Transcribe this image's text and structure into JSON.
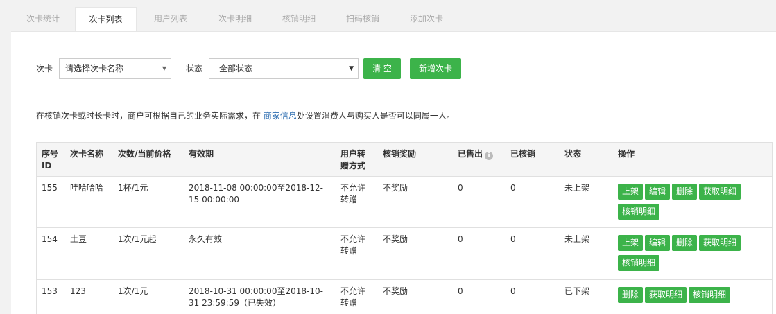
{
  "tabs": [
    {
      "label": "次卡统计",
      "active": false
    },
    {
      "label": "次卡列表",
      "active": true
    },
    {
      "label": "用户列表",
      "active": false
    },
    {
      "label": "次卡明细",
      "active": false
    },
    {
      "label": "核销明细",
      "active": false
    },
    {
      "label": "扫码核销",
      "active": false
    },
    {
      "label": "添加次卡",
      "active": false
    }
  ],
  "filters": {
    "card_label": "次卡",
    "card_select": "请选择次卡名称",
    "status_label": "状态",
    "status_select": "全部状态",
    "clear_button": "清 空",
    "add_button": "新增次卡"
  },
  "notice": {
    "before": "在核销次卡或时长卡时，商户可根据自己的业务实际需求，在 ",
    "link": "商家信息",
    "after": "处设置消费人与购买人是否可以同属一人。"
  },
  "table": {
    "headers": {
      "id": "序号ID",
      "name": "次卡名称",
      "count_price": "次数/当前价格",
      "validity": "有效期",
      "gift": "用户转赠方式",
      "reward": "核销奖励",
      "sold": "已售出",
      "verified": "已核销",
      "status": "状态",
      "ops": "操作"
    },
    "rows": [
      {
        "id": "155",
        "name": "哇哈哈哈",
        "count_price": "1杯/1元",
        "validity": "2018-11-08 00:00:00至2018-12-15 00:00:00",
        "gift": "不允许转赠",
        "reward": "不奖励",
        "sold": "0",
        "verified": "0",
        "status": "未上架",
        "ops": [
          "上架",
          "编辑",
          "删除",
          "获取明细",
          "核销明细"
        ]
      },
      {
        "id": "154",
        "name": "土豆",
        "count_price": "1次/1元起",
        "validity": "永久有效",
        "gift": "不允许转赠",
        "reward": "不奖励",
        "sold": "0",
        "verified": "0",
        "status": "未上架",
        "ops": [
          "上架",
          "编辑",
          "删除",
          "获取明细",
          "核销明细"
        ]
      },
      {
        "id": "153",
        "name": "123",
        "count_price": "1次/1元",
        "validity": "2018-10-31 00:00:00至2018-10-31 23:59:59（已失效）",
        "gift": "不允许转赠",
        "reward": "不奖励",
        "sold": "0",
        "verified": "0",
        "status": "已下架",
        "ops": [
          "删除",
          "获取明细",
          "核销明细"
        ]
      }
    ]
  },
  "colors": {
    "accent": "#3cb34a",
    "link": "#2b6cb0"
  },
  "icons": {
    "sold_info": "info-icon",
    "select_arrow": "caret-down-icon"
  }
}
